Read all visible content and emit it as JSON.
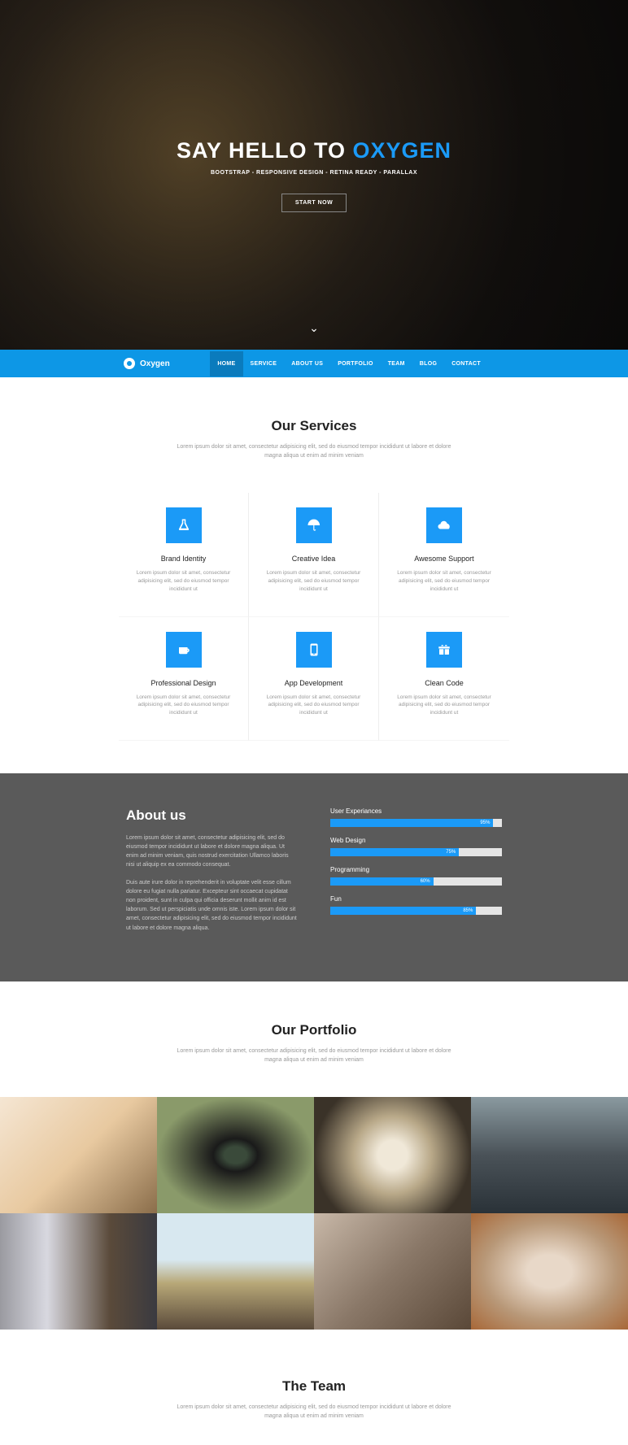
{
  "hero": {
    "title_prefix": "SAY HELLO TO ",
    "title_accent": "OXYGEN",
    "subtitle": "BOOTSTRAP - RESPONSIVE DESIGN - RETINA READY - PARALLAX",
    "cta": "START NOW"
  },
  "nav": {
    "brand": "Oxygen",
    "items": [
      "HOME",
      "SERVICE",
      "ABOUT US",
      "PORTFOLIO",
      "TEAM",
      "BLOG",
      "CONTACT"
    ],
    "active_index": 0
  },
  "services": {
    "title": "Our Services",
    "desc": "Lorem ipsum dolor sit amet, consectetur adipisicing elit, sed do eiusmod tempor incididunt ut labore et dolore magna aliqua ut enim ad minim veniam",
    "items": [
      {
        "icon": "flask",
        "title": "Brand Identity",
        "desc": "Lorem ipsum dolor sit amet, consectetur adipisicing elit, sed do eiusmod tempor incididunt ut"
      },
      {
        "icon": "umbrella",
        "title": "Creative Idea",
        "desc": "Lorem ipsum dolor sit amet, consectetur adipisicing elit, sed do eiusmod tempor incididunt ut"
      },
      {
        "icon": "cloud",
        "title": "Awesome Support",
        "desc": "Lorem ipsum dolor sit amet, consectetur adipisicing elit, sed do eiusmod tempor incididunt ut"
      },
      {
        "icon": "coffee",
        "title": "Professional Design",
        "desc": "Lorem ipsum dolor sit amet, consectetur adipisicing elit, sed do eiusmod tempor incididunt ut"
      },
      {
        "icon": "mobile",
        "title": "App Development",
        "desc": "Lorem ipsum dolor sit amet, consectetur adipisicing elit, sed do eiusmod tempor incididunt ut"
      },
      {
        "icon": "gift",
        "title": "Clean Code",
        "desc": "Lorem ipsum dolor sit amet, consectetur adipisicing elit, sed do eiusmod tempor incididunt ut"
      }
    ]
  },
  "about": {
    "title": "About us",
    "para1": "Lorem ipsum dolor sit amet, consectetur adipisicing elit, sed do eiusmod tempor incididunt ut labore et dolore magna aliqua. Ut enim ad minim veniam, quis nostrud exercitation Ullamco laboris nisi ut aliquip ex ea commodo consequat.",
    "para2": "Duis aute irure dolor in reprehenderit in voluptate velit esse cillum dolore eu fugiat nulla pariatur. Excepteur sint occaecat cupidatat non proident, sunt in culpa qui officia deserunt mollit anim id est laborum. Sed ut perspiciatis unde omnis iste. Lorem ipsum dolor sit amet, consectetur adipisicing elit, sed do eiusmod tempor incididunt ut labore et dolore magna aliqua.",
    "skills": [
      {
        "name": "User Experiances",
        "pct": 95
      },
      {
        "name": "Web Design",
        "pct": 75
      },
      {
        "name": "Programming",
        "pct": 60
      },
      {
        "name": "Fun",
        "pct": 85
      }
    ]
  },
  "portfolio": {
    "title": "Our Portfolio",
    "desc": "Lorem ipsum dolor sit amet, consectetur adipisicing elit, sed do eiusmod tempor incididunt ut labore et dolore magna aliqua ut enim ad minim veniam"
  },
  "team": {
    "title": "The Team",
    "desc": "Lorem ipsum dolor sit amet, consectetur adipisicing elit, sed do eiusmod tempor incididunt ut labore et dolore magna aliqua ut enim ad minim veniam"
  }
}
